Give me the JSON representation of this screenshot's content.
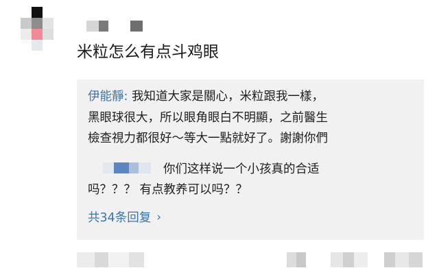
{
  "post": {
    "author_name": "",
    "text": "米粒怎么有点斗鸡眼"
  },
  "reply_1": {
    "author": "伊能靜",
    "separator": ":",
    "line_1": " 我知道大家是關心，米粒跟我一樣，",
    "line_2": "黑眼球很大，所以眼角眼白不明顯，之前醫生",
    "line_3": "檢查視力都很好～等大一點就好了。謝謝你們"
  },
  "reply_2": {
    "line_1": "你们这样说一个小孩真的合适",
    "line_2": "吗？？？ 有点教养可以吗？？"
  },
  "reply_count": {
    "label": "共34条回复",
    "chevron": "›"
  },
  "colors": {
    "link_blue": "#3a73b0",
    "reply_bg": "#f1f1f1"
  }
}
